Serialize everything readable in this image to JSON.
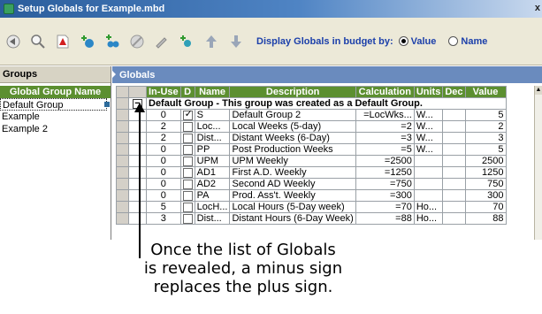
{
  "window": {
    "title": "Setup Globals for Example.mbd",
    "close_glyph": "x"
  },
  "toolbar": {
    "display_label": "Display Globals in budget by:",
    "option_value": "Value",
    "option_name": "Name",
    "selected": "Value"
  },
  "groups": {
    "header": "Groups",
    "column_header": "Global Group Name",
    "items": [
      "Default Group",
      "Example",
      "Example 2"
    ]
  },
  "globals": {
    "header": "Globals",
    "columns": [
      "In-Use",
      "D",
      "Name",
      "Description",
      "Calculation",
      "Units",
      "Dec",
      "Value"
    ],
    "group_row": "Default Group - This group was created as a Default Group.",
    "rows": [
      {
        "inuse": "0",
        "d": true,
        "name": "S",
        "description": "Default Group 2",
        "calculation": "=LocWks...",
        "units": "W...",
        "dec": "",
        "value": "5"
      },
      {
        "inuse": "2",
        "d": false,
        "name": "Loc...",
        "description": "Local Weeks (5-day)",
        "calculation": "=2",
        "units": "W...",
        "dec": "",
        "value": "2"
      },
      {
        "inuse": "2",
        "d": false,
        "name": "Dist...",
        "description": "Distant Weeks (6-Day)",
        "calculation": "=3",
        "units": "W...",
        "dec": "",
        "value": "3"
      },
      {
        "inuse": "0",
        "d": false,
        "name": "PP",
        "description": "Post Production Weeks",
        "calculation": "=5",
        "units": "W...",
        "dec": "",
        "value": "5"
      },
      {
        "inuse": "0",
        "d": false,
        "name": "UPM",
        "description": "UPM Weekly",
        "calculation": "=2500",
        "units": "",
        "dec": "",
        "value": "2500"
      },
      {
        "inuse": "0",
        "d": false,
        "name": "AD1",
        "description": "First A.D. Weekly",
        "calculation": "=1250",
        "units": "",
        "dec": "",
        "value": "1250"
      },
      {
        "inuse": "0",
        "d": false,
        "name": "AD2",
        "description": "Second AD Weekly",
        "calculation": "=750",
        "units": "",
        "dec": "",
        "value": "750"
      },
      {
        "inuse": "0",
        "d": false,
        "name": "PA",
        "description": "Prod. Ass't. Weekly",
        "calculation": "=300",
        "units": "",
        "dec": "",
        "value": "300"
      },
      {
        "inuse": "5",
        "d": false,
        "name": "LocH...",
        "description": "Local Hours (5-Day week)",
        "calculation": "=70",
        "units": "Ho...",
        "dec": "",
        "value": "70"
      },
      {
        "inuse": "3",
        "d": false,
        "name": "Dist...",
        "description": "Distant Hours (6-Day Week)",
        "calculation": "=88",
        "units": "Ho...",
        "dec": "",
        "value": "88"
      }
    ]
  },
  "callout": {
    "line1": "Once the list of Globals",
    "line2": "is revealed, a minus sign",
    "line3": "replaces the plus sign."
  },
  "icons": [
    "app-icon",
    "back-icon",
    "search-icon",
    "pdf-icon",
    "add-global-icon",
    "add-group-icon",
    "delete-icon",
    "edit-icon",
    "sort-icon",
    "move-up-icon",
    "move-down-icon",
    "minus-sign-icon",
    "leader-arrow-icon"
  ]
}
